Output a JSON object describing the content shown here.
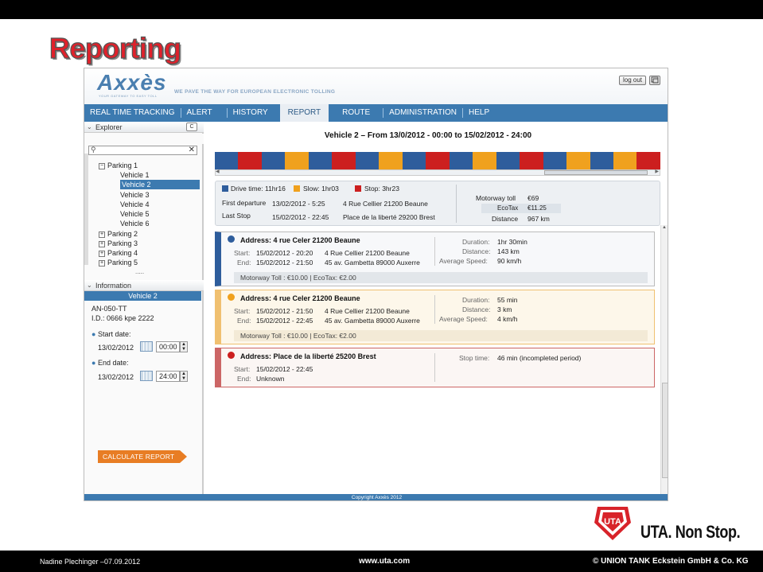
{
  "slide": {
    "title": "Reporting",
    "footer_left": "Nadine Plechinger –07.09.2012",
    "footer_mid": "www.uta.com",
    "footer_right": "© UNION TANK Eckstein GmbH & Co. KG",
    "brand_slogan": "UTA. Non Stop.",
    "brand_logo": "UTA"
  },
  "app": {
    "logo": "Axxès",
    "logo_tag": "YOUR GATEWAY TO EASY TOLL",
    "slogan": "WE PAVE THE WAY FOR EUROPEAN ELECTRONIC TOLLING",
    "logout_label": "log out",
    "copyright": "Copyright Axxès 2012"
  },
  "nav": {
    "items": [
      "REAL TIME TRACKING",
      "ALERT",
      "HISTORY",
      "REPORT",
      "ROUTE",
      "ADMINISTRATION",
      "HELP"
    ],
    "active": "REPORT"
  },
  "sidebar": {
    "collapse_label": "C",
    "explorer_label": "Explorer",
    "search_placeholder": "",
    "tree": {
      "parking1": "Parking 1",
      "vehicles": [
        "Vehicle 1",
        "Vehicle 2",
        "Vehicle 3",
        "Vehicle 4",
        "Vehicle 5",
        "Vehicle 6"
      ],
      "selected_vehicle": "Vehicle 2",
      "parkings": [
        "Parking 2",
        "Parking 3",
        "Parking 4",
        "Parking 5"
      ],
      "more": "....."
    },
    "information_label": "Information",
    "info": {
      "title": "Vehicle 2",
      "plate": "AN-050-TT",
      "id": "I.D.: 0666 kpe 2222",
      "start_label": "Start date:",
      "start_date": "13/02/2012",
      "start_time": "00:00",
      "end_label": "End date:",
      "end_date": "13/02/2012",
      "end_time": "24:00"
    },
    "calculate_label": "CALCULATE REPORT"
  },
  "report": {
    "title": "Vehicle 2 – From 13/0/2012 - 00:00 to 15/02/2012 - 24:00",
    "colors": {
      "drive": "#2e5d9c",
      "slow": "#f0a11e",
      "stop": "#cc1f1f"
    },
    "timeline": [
      "drive",
      "stop",
      "drive",
      "slow",
      "drive",
      "stop",
      "drive",
      "slow",
      "drive",
      "stop",
      "drive",
      "slow",
      "drive",
      "stop",
      "drive",
      "slow",
      "drive",
      "slow",
      "stop"
    ],
    "legend": {
      "drive": "Drive time: 11hr16",
      "slow": "Slow: 1hr03",
      "stop": "Stop: 3hr23"
    },
    "first_departure_label": "First departure",
    "first_departure_time": "13/02/2012 - 5:25",
    "first_departure_addr": "4 Rue Cellier 21200 Beaune",
    "last_stop_label": "Last Stop",
    "last_stop_time": "15/02/2012 - 22:45",
    "last_stop_addr": "Place de la liberté 29200 Brest",
    "motorway_toll_label": "Motorway toll",
    "motorway_toll": "€69",
    "ecotax_label": "EcoTax",
    "ecotax": "€11.25",
    "distance_label": "Distance",
    "distance": "967 km"
  },
  "trips": [
    {
      "kind": "drive",
      "address": "Address: 4 rue Celer 21200 Beaune",
      "start_label": "Start:",
      "start_time": "15/02/2012 - 20:20",
      "start_addr": "4 Rue Cellier 21200 Beaune",
      "end_label": "End:",
      "end_time": "15/02/2012 - 21:50",
      "end_addr": "45 av. Gambetta 89000 Auxerre",
      "duration_label": "Duration:",
      "duration": "1hr 30min",
      "distance_label": "Distance:",
      "distance": "143 km",
      "speed_label": "Average Speed:",
      "speed": "90 km/h",
      "toll_text": "Motorway Toll :  €10.00   |  EcoTax:  €2.00"
    },
    {
      "kind": "slow",
      "address": "Address: 4 rue Celer 21200 Beaune",
      "start_label": "Start:",
      "start_time": "15/02/2012 - 21:50",
      "start_addr": "4 Rue Cellier 21200 Beaune",
      "end_label": "End:",
      "end_time": "15/02/2012 - 22:45",
      "end_addr": "45 av. Gambetta 89000 Auxerre",
      "duration_label": "Duration:",
      "duration": "55 min",
      "distance_label": "Distance:",
      "distance": "3 km",
      "speed_label": "Average Speed:",
      "speed": "4 km/h",
      "toll_text": "Motorway Toll :  €10.00   |  EcoTax:  €2.00"
    },
    {
      "kind": "stop",
      "address": "Address: Place de la liberté 25200 Brest",
      "start_label": "Start:",
      "start_time": "15/02/2012 - 22:45",
      "end_label": "End:",
      "end_time": "Unknown",
      "stop_time_label": "Stop time:",
      "stop_time": "46 min (incompleted period)"
    }
  ]
}
